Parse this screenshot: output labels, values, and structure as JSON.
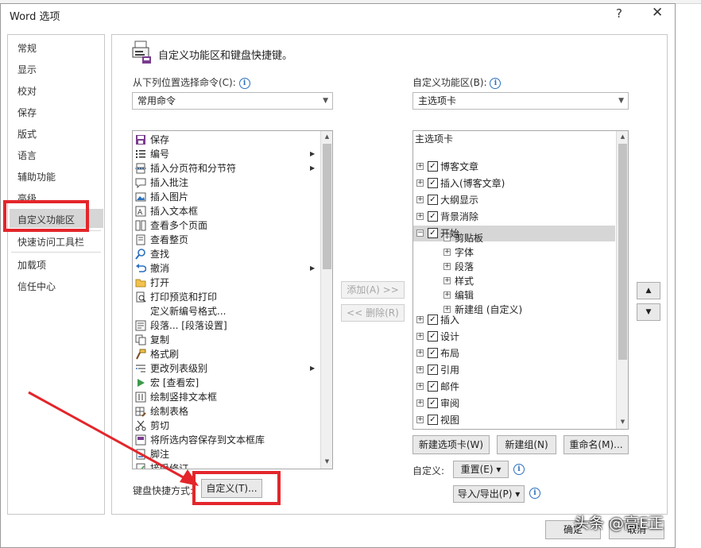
{
  "window": {
    "title": "Word 选项",
    "help_glyph": "?",
    "close_glyph": "✕"
  },
  "nav": {
    "items": [
      "常规",
      "显示",
      "校对",
      "保存",
      "版式",
      "语言",
      "辅助功能",
      "高级",
      "自定义功能区",
      "快速访问工具栏",
      "加载项",
      "信任中心"
    ],
    "selected": "自定义功能区"
  },
  "header": {
    "text": "自定义功能区和键盘快捷键。"
  },
  "left": {
    "label": "从下列位置选择命令(C):",
    "combo_value": "常用命令",
    "commands": [
      {
        "label": "保存",
        "icon": "save-icon",
        "sub": ""
      },
      {
        "label": "编号",
        "icon": "numbering-icon",
        "sub": "▶"
      },
      {
        "label": "插入分页符和分节符",
        "icon": "page-break-icon",
        "sub": "▶"
      },
      {
        "label": "插入批注",
        "icon": "comment-icon",
        "sub": ""
      },
      {
        "label": "插入图片",
        "icon": "picture-icon",
        "sub": ""
      },
      {
        "label": "插入文本框",
        "icon": "textbox-icon",
        "sub": ""
      },
      {
        "label": "查看多个页面",
        "icon": "multi-page-icon",
        "sub": ""
      },
      {
        "label": "查看整页",
        "icon": "full-page-icon",
        "sub": ""
      },
      {
        "label": "查找",
        "icon": "find-icon",
        "sub": ""
      },
      {
        "label": "撤消",
        "icon": "undo-icon",
        "sub": "▶"
      },
      {
        "label": "打开",
        "icon": "open-folder-icon",
        "sub": ""
      },
      {
        "label": "打印预览和打印",
        "icon": "print-preview-icon",
        "sub": ""
      },
      {
        "label": "定义新编号格式...",
        "icon": "",
        "sub": ""
      },
      {
        "label": "段落... [段落设置]",
        "icon": "paragraph-icon",
        "sub": ""
      },
      {
        "label": "复制",
        "icon": "copy-icon",
        "sub": ""
      },
      {
        "label": "格式刷",
        "icon": "format-painter-icon",
        "sub": ""
      },
      {
        "label": "更改列表级别",
        "icon": "list-level-icon",
        "sub": "▶"
      },
      {
        "label": "宏 [查看宏]",
        "icon": "macro-icon",
        "sub": ""
      },
      {
        "label": "绘制竖排文本框",
        "icon": "vertical-textbox-icon",
        "sub": ""
      },
      {
        "label": "绘制表格",
        "icon": "draw-table-icon",
        "sub": ""
      },
      {
        "label": "剪切",
        "icon": "cut-icon",
        "sub": ""
      },
      {
        "label": "将所选内容保存到文本框库",
        "icon": "save-selection-icon",
        "sub": ""
      },
      {
        "label": "脚注",
        "icon": "footnote-icon",
        "sub": ""
      },
      {
        "label": "接受修订",
        "icon": "accept-revision-icon",
        "sub": ""
      }
    ]
  },
  "middle": {
    "add": "添加(A) >>",
    "remove": "<< 删除(R)"
  },
  "right": {
    "label": "自定义功能区(B):",
    "combo_value": "主选项卡",
    "tree": [
      {
        "label": "主选项卡",
        "level": 0,
        "pm": "",
        "cb": false,
        "hl": false
      },
      {
        "label": "博客文章",
        "level": 1,
        "pm": "+",
        "cb": true,
        "hl": false
      },
      {
        "label": "插入(博客文章)",
        "level": 1,
        "pm": "+",
        "cb": true,
        "hl": false
      },
      {
        "label": "大纲显示",
        "level": 1,
        "pm": "+",
        "cb": true,
        "hl": false
      },
      {
        "label": "背景消除",
        "level": 1,
        "pm": "+",
        "cb": true,
        "hl": false
      },
      {
        "label": "开始",
        "level": 1,
        "pm": "−",
        "cb": true,
        "hl": true
      },
      {
        "label": "剪贴板",
        "level": 2,
        "pm": "+",
        "cb": false,
        "hl": false
      },
      {
        "label": "字体",
        "level": 2,
        "pm": "+",
        "cb": false,
        "hl": false
      },
      {
        "label": "段落",
        "level": 2,
        "pm": "+",
        "cb": false,
        "hl": false
      },
      {
        "label": "样式",
        "level": 2,
        "pm": "+",
        "cb": false,
        "hl": false
      },
      {
        "label": "编辑",
        "level": 2,
        "pm": "+",
        "cb": false,
        "hl": false
      },
      {
        "label": "新建组 (自定义)",
        "level": 2,
        "pm": "+",
        "cb": false,
        "hl": false
      },
      {
        "label": "插入",
        "level": 1,
        "pm": "+",
        "cb": true,
        "hl": false
      },
      {
        "label": "设计",
        "level": 1,
        "pm": "+",
        "cb": true,
        "hl": false
      },
      {
        "label": "布局",
        "level": 1,
        "pm": "+",
        "cb": true,
        "hl": false
      },
      {
        "label": "引用",
        "level": 1,
        "pm": "+",
        "cb": true,
        "hl": false
      },
      {
        "label": "邮件",
        "level": 1,
        "pm": "+",
        "cb": true,
        "hl": false
      },
      {
        "label": "审阅",
        "level": 1,
        "pm": "+",
        "cb": true,
        "hl": false
      },
      {
        "label": "视图",
        "level": 1,
        "pm": "+",
        "cb": true,
        "hl": false
      }
    ],
    "new_tab": "新建选项卡(W)",
    "new_group": "新建组(N)",
    "rename": "重命名(M)...",
    "customize_label": "自定义:",
    "reset": "重置(E) ▾",
    "import_export": "导入/导出(P) ▾",
    "up": "▲",
    "down": "▼"
  },
  "shortcut": {
    "label": "键盘快捷方式:",
    "button": "自定义(T)..."
  },
  "footer": {
    "ok": "确定",
    "cancel": "取消"
  },
  "watermark": "头条 @高E正",
  "colors": {
    "annotation": "#e3262b",
    "selection": "#d6d6d6",
    "info": "#2b6fbf"
  }
}
